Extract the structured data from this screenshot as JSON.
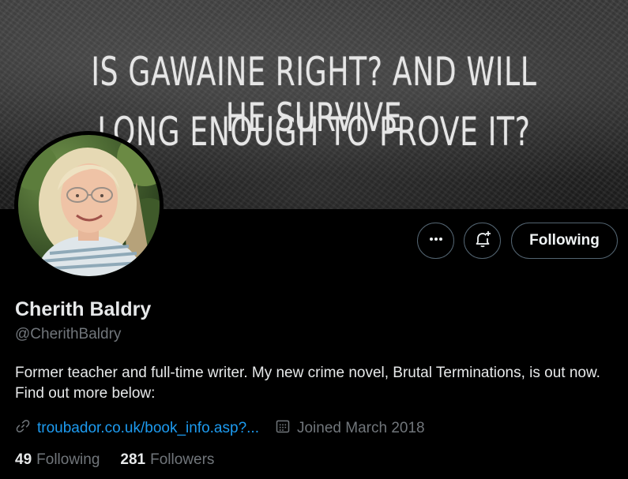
{
  "banner": {
    "line1": "IS GAWAINE RIGHT? AND WILL HE SURVIVE",
    "line2": "LONG ENOUGH TO PROVE IT?"
  },
  "actions": {
    "more_icon": "more-horizontal-icon",
    "notify_icon": "bell-plus-icon",
    "following_label": "Following"
  },
  "profile": {
    "name": "Cherith Baldry",
    "handle": "@CherithBaldry",
    "bio": "Former teacher and full-time writer. My new crime novel, Brutal Terminations, is out now. Find out more below:",
    "link_icon": "link-icon",
    "link_text": "troubador.co.uk/book_info.asp?...",
    "joined_icon": "calendar-icon",
    "joined_text": "Joined March 2018"
  },
  "stats": {
    "following_count": "49",
    "following_label": "Following",
    "followers_count": "281",
    "followers_label": "Followers"
  },
  "colors": {
    "background": "#000000",
    "primary_text": "#e7e9ea",
    "secondary_text": "#71767b",
    "link": "#1d9bf0",
    "border": "#536471"
  }
}
